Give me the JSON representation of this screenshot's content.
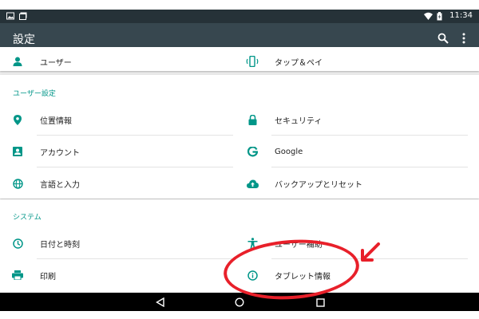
{
  "status_bar": {
    "time": "11:34",
    "icons_left": [
      "image-icon",
      "photos-icon"
    ],
    "icons_right": [
      "wifi-icon",
      "battery-icon"
    ]
  },
  "toolbar": {
    "title": "設定",
    "actions": [
      "search-icon",
      "more-vert-icon"
    ]
  },
  "top_row": {
    "left": {
      "label": "ユーザー",
      "icon": "person-icon"
    },
    "right": {
      "label": "タップ＆ペイ",
      "icon": "tap-pay-icon"
    }
  },
  "user_settings": {
    "header": "ユーザー設定",
    "items": [
      {
        "label": "位置情報",
        "icon": "location-icon"
      },
      {
        "label": "セキュリティ",
        "icon": "lock-icon"
      },
      {
        "label": "アカウント",
        "icon": "account-box-icon"
      },
      {
        "label": "Google",
        "icon": "google-icon"
      },
      {
        "label": "言語と入力",
        "icon": "globe-icon"
      },
      {
        "label": "バックアップとリセット",
        "icon": "cloud-upload-icon"
      }
    ]
  },
  "system": {
    "header": "システム",
    "items": [
      {
        "label": "日付と時刻",
        "icon": "clock-icon"
      },
      {
        "label": "ユーザー補助",
        "icon": "accessibility-icon"
      },
      {
        "label": "印刷",
        "icon": "print-icon"
      },
      {
        "label": "タブレット情報",
        "icon": "info-icon"
      }
    ]
  },
  "nav_bar": {
    "buttons": [
      "back-icon",
      "home-icon",
      "recents-icon"
    ]
  },
  "colors": {
    "status_bar": "#263238",
    "toolbar": "#37474f",
    "accent": "#009688",
    "annotation": "#e8202a"
  }
}
